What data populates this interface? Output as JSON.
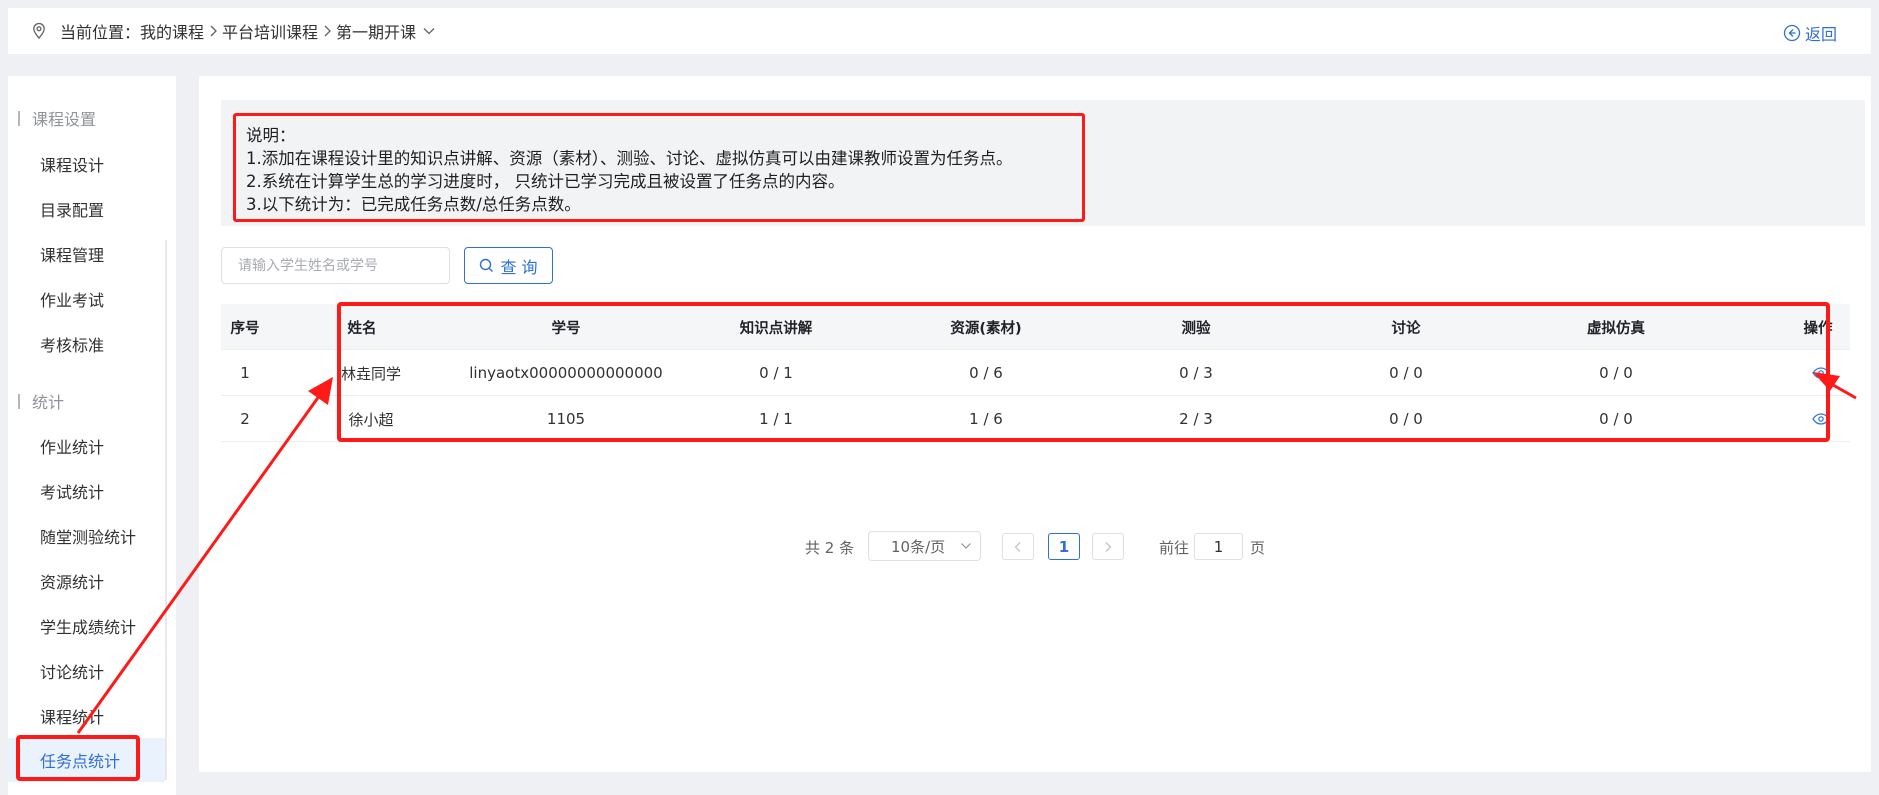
{
  "breadcrumb": {
    "prefix": "当前位置：",
    "items": [
      "我的课程",
      "平台培训课程",
      "第一期开课"
    ]
  },
  "back_label": "返回",
  "sidebar": {
    "groups": [
      {
        "title": "课程设置",
        "items": [
          "课程设计",
          "目录配置",
          "课程管理",
          "作业考试",
          "考核标准"
        ]
      },
      {
        "title": "统计",
        "items": [
          "作业统计",
          "考试统计",
          "随堂测验统计",
          "资源统计",
          "学生成绩统计",
          "讨论统计",
          "课程统计",
          "任务点统计"
        ]
      }
    ],
    "active_item": "任务点统计"
  },
  "notice": {
    "lines": [
      "说明：",
      "1.添加在课程设计里的知识点讲解、资源（素材）、测验、讨论、虚拟仿真可以由建课教师设置为任务点。",
      "2.系统在计算学生总的学习进度时， 只统计已学习完成且被设置了任务点的内容。",
      "3.以下统计为：已完成任务点数/总任务点数。"
    ]
  },
  "search": {
    "placeholder": "请输入学生姓名或学号",
    "value": "",
    "button_label": "查 询"
  },
  "table": {
    "columns": [
      "序号",
      "姓名",
      "学号",
      "知识点讲解",
      "资源(素材)",
      "测验",
      "讨论",
      "虚拟仿真",
      "操作"
    ],
    "rows": [
      {
        "index": "1",
        "name": "林垚同学",
        "student_id": "linyaotx00000000000000",
        "knowledge": "0 / 1",
        "resource": "0 / 6",
        "quiz": "0 / 3",
        "discussion": "0 / 0",
        "simulation": "0 / 0",
        "action_icon": "eye-icon"
      },
      {
        "index": "2",
        "name": "徐小超",
        "student_id": "1105",
        "knowledge": "1 / 1",
        "resource": "1 / 6",
        "quiz": "2 / 3",
        "discussion": "0 / 0",
        "simulation": "0 / 0",
        "action_icon": "eye-icon"
      }
    ]
  },
  "pagination": {
    "total_label": "共 2 条",
    "page_size": "10条/页",
    "current_page": "1",
    "goto_label": "前往",
    "goto_value": "1",
    "page_suffix": "页"
  },
  "colors": {
    "accent": "#2f6fd6",
    "annotation": "#ff1a1a",
    "active_bg": "#eaf2fd"
  },
  "icons": [
    "location-icon",
    "chevron-right-icon",
    "chevron-down-icon",
    "back-icon",
    "search-icon",
    "eye-icon",
    "chevron-left-icon"
  ]
}
